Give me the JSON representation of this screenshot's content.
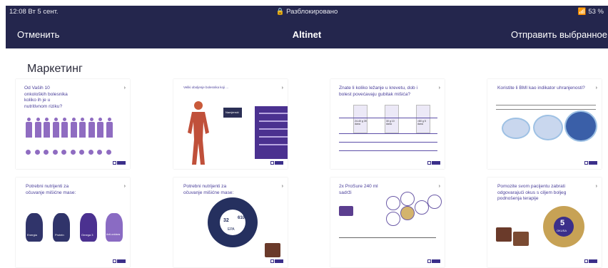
{
  "status_bar": {
    "time": "12:08",
    "date": "Вт 5 сент.",
    "lock": "Разблокировано",
    "battery": "53 %"
  },
  "nav": {
    "cancel": "Отменить",
    "title": "Altinet",
    "send": "Отправить выбранное"
  },
  "section": {
    "title": "Маркетинг"
  },
  "slides": [
    {
      "title": "Od Vaših 10 onkoloških bolesnika koliko ih je u nutritivnom riziku?"
    },
    {
      "title": "Veliki oboljenje bolesnika koji ...",
      "box": "Namjenski"
    },
    {
      "title": "Znate li koliko ležanje u krevetu, dob i bolest povećavaju gubitak mišića?",
      "cols": [
        "24-40 g 39 dana",
        "30 g 10 dana",
        ">80 g 5 dana"
      ]
    },
    {
      "title": "Koristite li BMI kao indikator uhranjenosti?"
    },
    {
      "title": "Potrebni nutrijenti za očuvanje mišićne mase:",
      "labels": [
        "Energia",
        "Protein",
        "Omega 3",
        "Anti-oxidans"
      ]
    },
    {
      "title": "Potrebni nutrijenti za očuvanje mišićne mase:",
      "numbers": [
        "32",
        "610",
        "EPA"
      ]
    },
    {
      "title": "2x ProSure 240 ml sadrži"
    },
    {
      "title": "Pomozite svom pacijentu zabrati odgovarajući okus s ciljem boljeg podnošenja terapije",
      "badge": "5",
      "badge_label": "OKUSA"
    }
  ]
}
